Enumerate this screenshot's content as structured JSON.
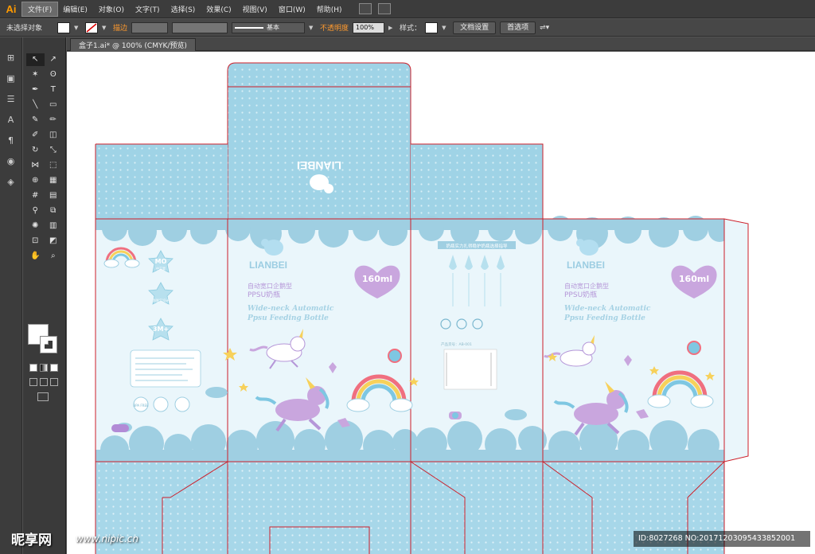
{
  "app": {
    "logo": "Ai"
  },
  "menu": [
    "文件(F)",
    "编辑(E)",
    "对象(O)",
    "文字(T)",
    "选择(S)",
    "效果(C)",
    "视图(V)",
    "窗口(W)",
    "帮助(H)"
  ],
  "control": {
    "no_selection": "未选择对象",
    "stroke_label": "描边",
    "stroke_style": "基本",
    "opacity_label": "不透明度",
    "opacity_value": "100%",
    "style_label": "样式",
    "doc_settings": "文档设置",
    "preferences": "首选项"
  },
  "document": {
    "tab": "盒子1.ai* @ 100% (CMYK/预览)"
  },
  "package": {
    "brand": "LIANBEI",
    "capacity": "160ml",
    "title_cn": "自动宽口企鹅型",
    "subtitle_cn": "PPSU奶瓶",
    "title_en_1": "Wide-neck Automatic",
    "title_en_2": "Ppsu Feeding Bottle",
    "badge_1_big": "MO",
    "badge_1_small": "中英婴",
    "badge_2_small": "防胀气设计",
    "badge_3_big": "3M+",
    "badge_4": "BPA FREE",
    "side_header": "奶瓶实力扎得稳护奶瓶选择指导",
    "side_code": "产品货号：AB-001"
  },
  "watermark": {
    "logo": "昵享网",
    "url": "www.nipic.cn",
    "id": "ID:8027268 NO:20171203095433852001"
  },
  "colors": {
    "box_blue": "#9fd3e6",
    "box_light": "#eaf6fb",
    "cloud": "#9fcfe2",
    "dieline": "#cc1f2a",
    "purple": "#b596d8",
    "heart": "#c9a6de"
  }
}
